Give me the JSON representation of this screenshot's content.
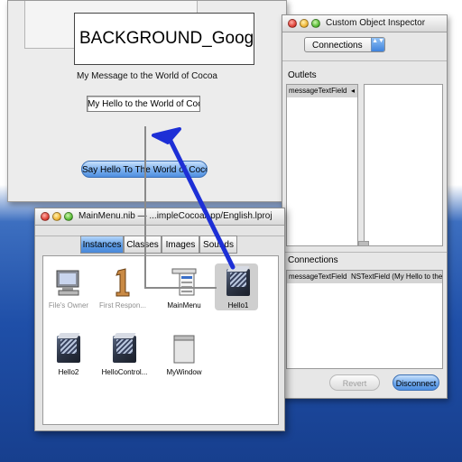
{
  "overlay": {
    "label": "BACKGROUND_Google"
  },
  "app_window": {
    "message_label": "My Message to the World of Cocoa",
    "message_field": "My Hello to the World of Cocoa!",
    "say_button": "Say Hello To The World of Cocoa"
  },
  "inspector": {
    "title": "Custom Object Inspector",
    "popup_value": "Connections",
    "popup_arrow": "▲▼",
    "outlets_label": "Outlets",
    "outlets": [
      {
        "name": "messageTextField",
        "marker": "◂"
      }
    ],
    "connections_label": "Connections",
    "connections": [
      {
        "source": "messageTextField",
        "destination": "NSTextField (My Hello to the"
      }
    ],
    "revert_label": "Revert",
    "disconnect_label": "Disconnect"
  },
  "nib_window": {
    "title": "MainMenu.nib — ...impleCocoaApp/English.lproj",
    "tabs": [
      "Instances",
      "Classes",
      "Images",
      "Sounds"
    ],
    "active_tab": "Instances",
    "items": [
      {
        "label": "File's Owner",
        "icon": "files-owner-icon"
      },
      {
        "label": "First Respon...",
        "icon": "first-responder-icon"
      },
      {
        "label": "MainMenu",
        "icon": "main-menu-icon"
      },
      {
        "label": "Hello1",
        "icon": "object-cube-icon"
      },
      {
        "label": "Hello2",
        "icon": "object-cube-icon"
      },
      {
        "label": "HelloControl...",
        "icon": "object-cube-icon"
      },
      {
        "label": "MyWindow",
        "icon": "window-icon"
      }
    ]
  },
  "colors": {
    "accent_blue": "#4f8fe0",
    "arrow_blue": "#1d2fd6",
    "desktop_blue": "#1f4fa8"
  }
}
